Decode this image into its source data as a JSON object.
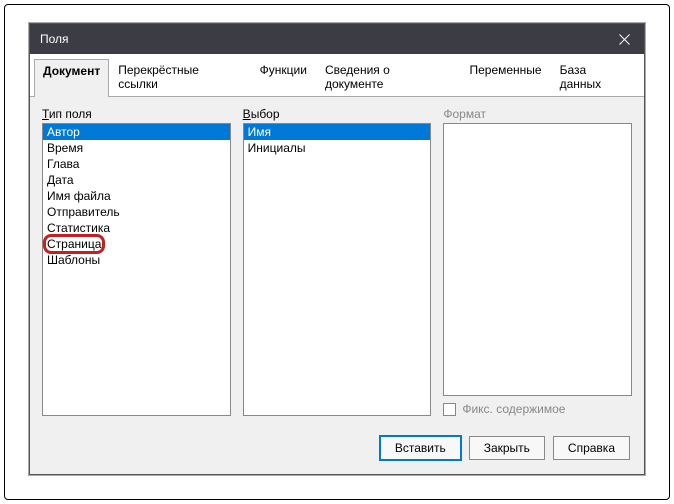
{
  "dialog": {
    "title": "Поля"
  },
  "tabs": {
    "items": [
      {
        "label": "Документ",
        "active": true
      },
      {
        "label": "Перекрёстные ссылки",
        "active": false
      },
      {
        "label": "Функции",
        "active": false
      },
      {
        "label": "Сведения о документе",
        "active": false
      },
      {
        "label": "Переменные",
        "active": false
      },
      {
        "label": "База данных",
        "active": false
      }
    ]
  },
  "columns": {
    "type": {
      "label": "Тип поля",
      "items": [
        {
          "text": "Автор",
          "selected": true
        },
        {
          "text": "Время",
          "selected": false
        },
        {
          "text": "Глава",
          "selected": false
        },
        {
          "text": "Дата",
          "selected": false
        },
        {
          "text": "Имя файла",
          "selected": false
        },
        {
          "text": "Отправитель",
          "selected": false
        },
        {
          "text": "Статистика",
          "selected": false
        },
        {
          "text": "Страница",
          "selected": false,
          "highlighted": true
        },
        {
          "text": "Шаблоны",
          "selected": false
        }
      ]
    },
    "select": {
      "label": "Выбор",
      "items": [
        {
          "text": "Имя",
          "selected": true
        },
        {
          "text": "Инициалы",
          "selected": false
        }
      ]
    },
    "format": {
      "label": "Формат",
      "items": []
    }
  },
  "checkbox": {
    "label": "Фикс. содержимое"
  },
  "buttons": {
    "insert": "Вставить",
    "close": "Закрыть",
    "help": "Справка"
  }
}
